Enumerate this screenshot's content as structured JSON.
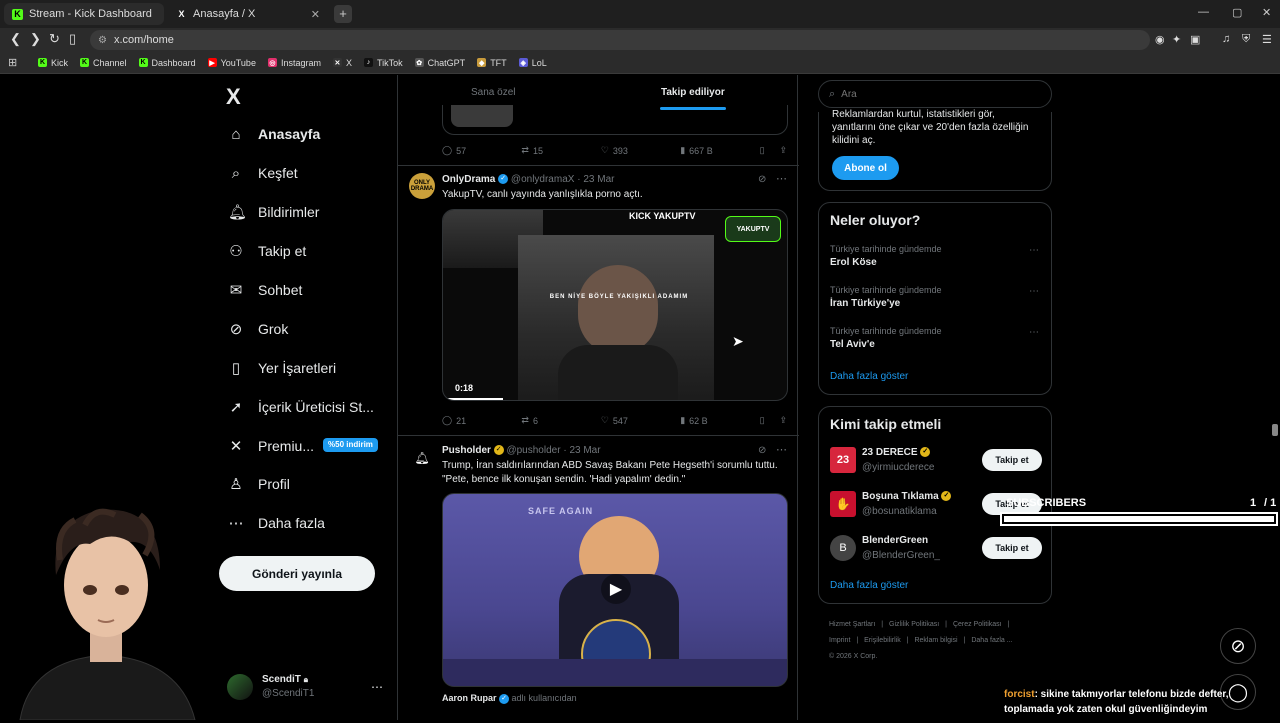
{
  "browser": {
    "tabs": [
      {
        "title": "Stream - Kick Dashboard",
        "fav": "K"
      },
      {
        "title": "Anasayfa / X",
        "fav": "X"
      }
    ],
    "url": "x.com/home",
    "bookmarks": [
      {
        "label": "Kick",
        "color": "#53fc18"
      },
      {
        "label": "Channel",
        "color": "#53fc18"
      },
      {
        "label": "Dashboard",
        "color": "#53fc18"
      },
      {
        "label": "YouTube",
        "color": "#ff0000"
      },
      {
        "label": "Instagram",
        "color": "#e1306c"
      },
      {
        "label": "X",
        "color": "#333333"
      },
      {
        "label": "TikTok",
        "color": "#111111"
      },
      {
        "label": "ChatGPT",
        "color": "#555555"
      },
      {
        "label": "TFT",
        "color": "#c89b3c"
      },
      {
        "label": "LoL",
        "color": "#5b5bd6"
      }
    ]
  },
  "nav": {
    "logo": "X",
    "items": [
      {
        "label": "Anasayfa",
        "icon": "home-icon",
        "glyph": "⌂"
      },
      {
        "label": "Keşfet",
        "icon": "search-icon",
        "glyph": "⌕"
      },
      {
        "label": "Bildirimler",
        "icon": "bell-icon",
        "glyph": "🔔︎"
      },
      {
        "label": "Takip et",
        "icon": "follow-icon",
        "glyph": "⚇"
      },
      {
        "label": "Sohbet",
        "icon": "mail-icon",
        "glyph": "✉"
      },
      {
        "label": "Grok",
        "icon": "grok-icon",
        "glyph": "⊘"
      },
      {
        "label": "Yer İşaretleri",
        "icon": "bookmark-icon",
        "glyph": "▯"
      },
      {
        "label": "İçerik Üreticisi St...",
        "icon": "rocket-icon",
        "glyph": "➚"
      },
      {
        "label": "Premiu...",
        "icon": "x-premium-icon",
        "glyph": "✕"
      },
      {
        "label": "Profil",
        "icon": "profile-icon",
        "glyph": "♙"
      },
      {
        "label": "Daha fazla",
        "icon": "more-icon",
        "glyph": "⋯"
      }
    ],
    "premium_badge": "%50 indirim",
    "post_button": "Gönderi yayınla",
    "account": {
      "name": "ScendiT",
      "handle": "@ScendiT1"
    }
  },
  "feed": {
    "tabs": [
      "Sana özel",
      "Takip ediliyor"
    ],
    "active_tab": "Takip ediliyor",
    "top_actions": {
      "replies": "57",
      "reposts": "15",
      "likes": "393",
      "views": "667 B"
    },
    "posts": [
      {
        "name": "OnlyDrama",
        "handle": "@onlydramaX",
        "date": "23 Mar",
        "text": "YakupTV, canlı yayında yanlışlıkla porno açtı.",
        "media_caption": "BEN NİYE BÖYLE YAKIŞIKLI ADAMIM",
        "media_brand": "KICK YAKUPTV",
        "duration": "0:18",
        "actions": {
          "replies": "21",
          "reposts": "6",
          "likes": "547",
          "views": "62 B"
        }
      },
      {
        "name": "Pusholder",
        "handle": "@pusholder",
        "date": "23 Mar",
        "text": "Trump, İran saldırılarından ABD Savaş Bakanı Pete Hegseth'i sorumlu tuttu. \"Pete, bence ilk konuşan sendin. 'Hadi yapalım' dedin.\"",
        "media_sign": "SAFE AGAIN",
        "quote_name": "Aaron Rupar",
        "quote_sub": "adlı kullanıcıdan"
      }
    ]
  },
  "sidebar": {
    "search_placeholder": "Ara",
    "premium_text_lines": [
      "Reklamlardan kurtul, istatistikleri gör,",
      "yanıtlarını öne çıkar ve 20'den fazla özelliğin",
      "kilidini aç."
    ],
    "premium_button": "Abone ol",
    "trends_title": "Neler oluyor?",
    "trends": [
      {
        "sub": "Türkiye tarihinde gündemde",
        "title": "Erol Köse"
      },
      {
        "sub": "Türkiye tarihinde gündemde",
        "title": "İran Türkiye'ye"
      },
      {
        "sub": "Türkiye tarihinde gündemde",
        "title": "Tel Aviv'e"
      }
    ],
    "trends_more": "Daha fazla göster",
    "who_title": "Kimi takip etmeli",
    "who": [
      {
        "name": "23 DERECE",
        "handle": "@yirmiucderece",
        "avatar": "23",
        "color": "#d7263d"
      },
      {
        "name": "Boşuna Tıklama",
        "handle": "@bosunatiklama",
        "avatar": "✋",
        "color": "#c8102e"
      },
      {
        "name": "BlenderGreen",
        "handle": "@BlenderGreen_",
        "avatar": "B",
        "color": "#444444"
      }
    ],
    "follow_label": "Takip et",
    "who_more": "Daha fazla göster",
    "footer": [
      "Hizmet Şartları",
      "Gizlilik Politikası",
      "Çerez Politikası",
      "Imprint",
      "Erişilebilirlik",
      "Reklam bilgisi",
      "Daha fazla ...",
      "© 2026 X Corp."
    ]
  },
  "overlay": {
    "subscribers_label": "SUBSCRIBERS",
    "subscribers_count": "1",
    "subscribers_goal": "/ 1",
    "chat_user": "forcist",
    "chat_message": ": sikine takmıyorlar telefonu bizde defter, toplamada yok zaten okul güvenliğindeyim"
  }
}
